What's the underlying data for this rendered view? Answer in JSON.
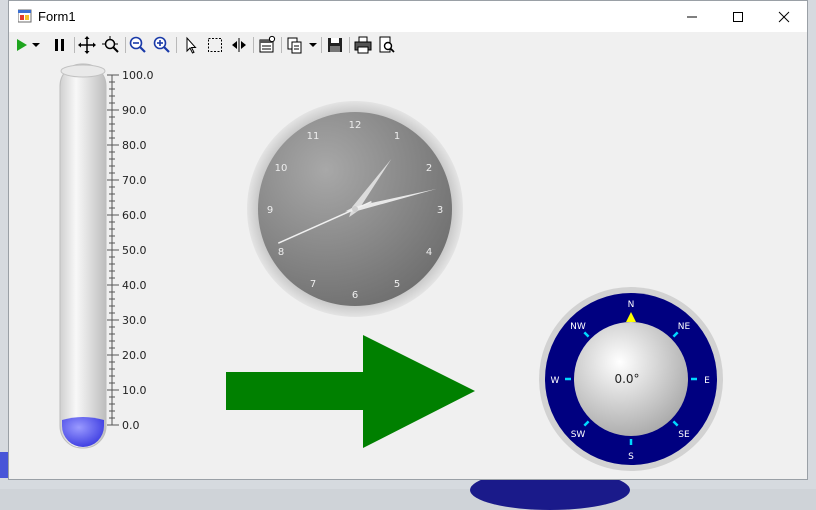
{
  "window": {
    "title": "Form1"
  },
  "title_buttons": {
    "minimize": "—",
    "maximize": "☐",
    "close": "✕"
  },
  "toolbar": {
    "tools": [
      {
        "name": "play-icon"
      },
      {
        "name": "dropdown-arrow-icon"
      },
      {
        "name": "pause-icon"
      },
      {
        "name": "pan-icon"
      },
      {
        "name": "zoom-fit-icon"
      },
      {
        "name": "zoom-out-icon"
      },
      {
        "name": "zoom-in-icon"
      },
      {
        "name": "pointer-icon"
      },
      {
        "name": "select-rect-icon"
      },
      {
        "name": "split-icon"
      },
      {
        "name": "properties-icon"
      },
      {
        "name": "copy-icon"
      },
      {
        "name": "dropdown-arrow-icon"
      },
      {
        "name": "save-icon"
      },
      {
        "name": "print-icon"
      },
      {
        "name": "print-preview-icon"
      }
    ]
  },
  "thermometer": {
    "tick_labels": [
      "100.0",
      "90.0",
      "80.0",
      "70.0",
      "60.0",
      "50.0",
      "40.0",
      "30.0",
      "20.0",
      "10.0",
      "0.0"
    ],
    "level": 0,
    "fill_color": "#5b5bf0"
  },
  "clock": {
    "numerals": [
      "12",
      "1",
      "2",
      "3",
      "4",
      "5",
      "6",
      "7",
      "8",
      "9",
      "10",
      "11"
    ],
    "hour": 1,
    "minute": 12,
    "second": 41
  },
  "arrow": {
    "color": "#008000",
    "direction": "right"
  },
  "compass": {
    "labels": [
      "N",
      "NE",
      "E",
      "SE",
      "S",
      "SW",
      "W",
      "NW"
    ],
    "heading_text": "0.0°",
    "heading": 0,
    "ring_color": "#000080",
    "marker_color": "#ffff00"
  }
}
